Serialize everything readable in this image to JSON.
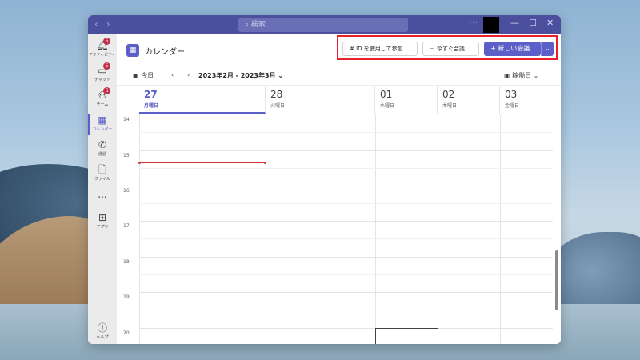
{
  "titlebar": {
    "search_placeholder": "検索"
  },
  "rail": [
    {
      "label": "アクティビティ",
      "badge": "5"
    },
    {
      "label": "チャット",
      "badge": "5"
    },
    {
      "label": "チーム",
      "badge": "6"
    },
    {
      "label": "カレンダー"
    },
    {
      "label": "通話"
    },
    {
      "label": "ファイル"
    },
    {
      "label": "..."
    },
    {
      "label": "アプリ"
    },
    {
      "label": "ヘルプ"
    }
  ],
  "header": {
    "title": "カレンダー",
    "join_with_id": "ID を使用して参加",
    "meet_now": "今すぐ会議",
    "new_meeting": "新しい会議"
  },
  "toolbar": {
    "today": "今日",
    "range": "2023年2月 - 2023年3月",
    "view": "稼働日"
  },
  "days": [
    {
      "num": "27",
      "name": "月曜日"
    },
    {
      "num": "28",
      "name": "火曜日"
    },
    {
      "num": "01",
      "name": "水曜日"
    },
    {
      "num": "02",
      "name": "木曜日"
    },
    {
      "num": "03",
      "name": "金曜日"
    }
  ],
  "hours": [
    "14",
    "15",
    "16",
    "17",
    "18",
    "19",
    "20"
  ],
  "colors": {
    "accent": "#5b5fc7",
    "titlebar": "#4b4f9e",
    "now_line": "#d13438",
    "highlight": "#e8202a"
  }
}
